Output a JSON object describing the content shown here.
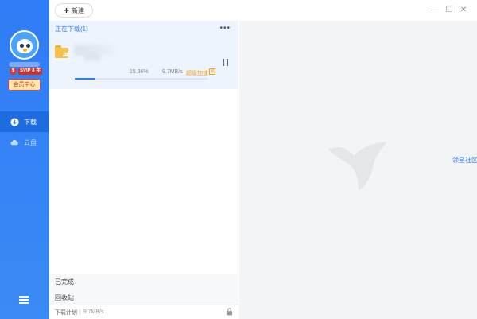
{
  "toolbar": {
    "new_label": "新建",
    "new_icon": "plus-icon"
  },
  "window_controls": {
    "minimize": "—",
    "maximize": "☐",
    "close": "✕"
  },
  "sidebar": {
    "vip_dollar": "$",
    "vip_label": "SVIP 8 年",
    "member_center": "会员中心",
    "nav": [
      {
        "label": "下载",
        "icon": "download-icon",
        "active": true
      },
      {
        "label": "云盘",
        "icon": "cloud-icon",
        "active": false
      }
    ],
    "menu_icon": "hamburger-menu-icon"
  },
  "downloads": {
    "header": "正在下载(1)",
    "more": "•••",
    "task": {
      "folder_badge": "BT",
      "percent_text": "15.36%",
      "progress": 0.1536,
      "speed": "9.7MB/s",
      "accel_label": "超级加速",
      "accel_badge": "限"
    },
    "completed_label": "已完成",
    "recycle_label": "回收站",
    "footer": {
      "plan_label": "下载计划",
      "speed": "9.7MB/s"
    }
  },
  "right": {
    "community_link": "领星社区"
  },
  "colors": {
    "brand": "#2f7cf6",
    "accent_orange": "#f0a020",
    "member_red": "#d92b2b"
  }
}
